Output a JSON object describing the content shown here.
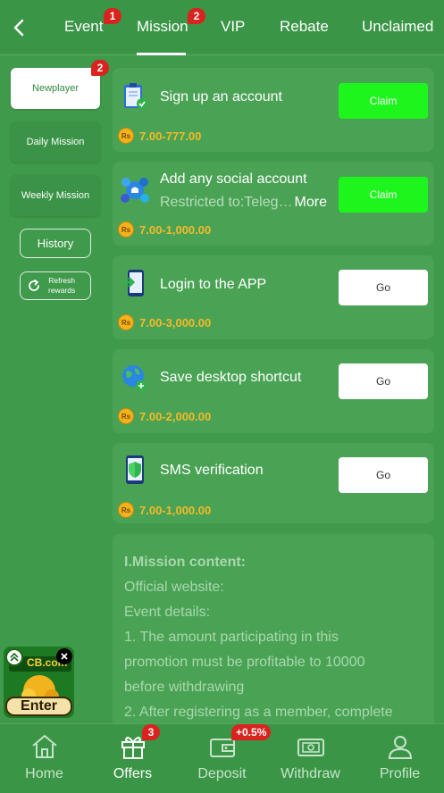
{
  "header": {
    "tabs": [
      {
        "label": "Event",
        "badge": "1"
      },
      {
        "label": "Mission",
        "badge": "2",
        "active": true
      },
      {
        "label": "VIP"
      },
      {
        "label": "Rebate"
      },
      {
        "label": "Unclaimed"
      }
    ]
  },
  "sidebar": {
    "items": [
      {
        "label": "Newplayer",
        "badge": "2",
        "active": true
      },
      {
        "label": "Daily Mission"
      },
      {
        "label": "Weekly Mission"
      }
    ],
    "history_label": "History",
    "refresh_label_1": "Refresh",
    "refresh_label_2": "rewards"
  },
  "missions": [
    {
      "title": "Sign up an account",
      "reward": "7.00-777.00",
      "action": "Claim",
      "icon": "clipboard-check-icon"
    },
    {
      "title": "Add any social account",
      "subtitle": "Restricted to:Teleg…",
      "more": "More",
      "reward": "7.00-1,000.00",
      "action": "Claim",
      "icon": "social-network-icon"
    },
    {
      "title": "Login to the APP",
      "reward": "7.00-3,000.00",
      "action": "Go",
      "icon": "phone-login-icon"
    },
    {
      "title": "Save desktop shortcut",
      "reward": "7.00-2,000.00",
      "action": "Go",
      "icon": "globe-link-icon"
    },
    {
      "title": "SMS verification",
      "reward": "7.00-1,000.00",
      "action": "Go",
      "icon": "phone-shield-icon"
    }
  ],
  "coin_label": "Rs",
  "info": {
    "title": "I.Mission content:",
    "lines": [
      "Official website:",
      "Event details:",
      "1. The amount participating in this",
      "promotion must be profitable to 10000",
      "before withdrawing",
      "2. After registering as a member, complete"
    ]
  },
  "promo": {
    "brand": "CB.com",
    "enter_label": "Enter"
  },
  "bottom_nav": [
    {
      "label": "Home",
      "icon": "home-icon"
    },
    {
      "label": "Offers",
      "icon": "gift-icon",
      "badge": "3",
      "active": true
    },
    {
      "label": "Deposit",
      "icon": "wallet-icon",
      "badge": "+0.5%"
    },
    {
      "label": "Withdraw",
      "icon": "cash-icon"
    },
    {
      "label": "Profile",
      "icon": "user-icon"
    }
  ],
  "colors": {
    "background": "#3f9a4b",
    "card": "#4aa355",
    "claim": "#1df51d",
    "reward": "#f5b927",
    "badge": "#d9231f"
  }
}
